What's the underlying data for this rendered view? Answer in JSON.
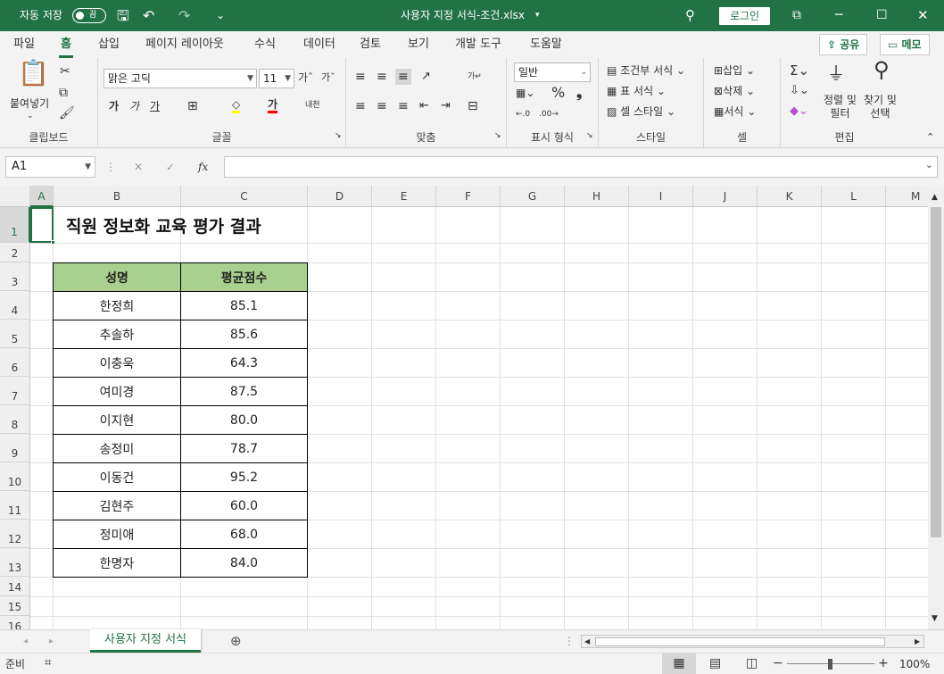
{
  "titlebar": {
    "autosave_label": "자동 저장",
    "autosave_state": "끔",
    "file_title": "사용자 지정 서식-조건.xlsx",
    "login": "로그인"
  },
  "tabs": [
    "파일",
    "홈",
    "삽입",
    "페이지 레이아웃",
    "수식",
    "데이터",
    "검토",
    "보기",
    "개발 도구",
    "도움말"
  ],
  "share_label": "공유",
  "memo_label": "메모",
  "ribbon": {
    "clipboard": {
      "paste": "붙여넣기",
      "label": "클립보드"
    },
    "font": {
      "name": "맑은 고딕",
      "size": "11",
      "label": "글꼴",
      "bold": "가",
      "italic": "가",
      "underline": "가",
      "color_glyph": "가"
    },
    "align": {
      "label": "맞춤"
    },
    "number": {
      "format": "일반",
      "label": "표시 형식",
      "percent": "%"
    },
    "styles": {
      "conditional": "조건부 서식",
      "table": "표 서식",
      "cell": "셀 스타일",
      "label": "스타일"
    },
    "cells": {
      "insert": "삽입",
      "delete": "삭제",
      "format": "서식",
      "label": "셀"
    },
    "editing": {
      "sort": "정렬 및\n필터",
      "find": "찾기 및\n선택",
      "label": "편집"
    }
  },
  "namebox": "A1",
  "columns": [
    "A",
    "B",
    "C",
    "D",
    "E",
    "F",
    "G",
    "H",
    "I",
    "J",
    "K",
    "L",
    "M"
  ],
  "rows": [
    "1",
    "2",
    "3",
    "4",
    "5",
    "6",
    "7",
    "8",
    "9",
    "10",
    "11",
    "12",
    "13",
    "14",
    "15",
    "16"
  ],
  "sheet": {
    "title": "직원 정보화 교육 평가 결과",
    "headers": [
      "성명",
      "평균점수"
    ],
    "data": [
      [
        "한정희",
        "85.1"
      ],
      [
        "추솔하",
        "85.6"
      ],
      [
        "이충욱",
        "64.3"
      ],
      [
        "여미경",
        "87.5"
      ],
      [
        "이지현",
        "80.0"
      ],
      [
        "송정미",
        "78.7"
      ],
      [
        "이동건",
        "95.2"
      ],
      [
        "김현주",
        "60.0"
      ],
      [
        "정미애",
        "68.0"
      ],
      [
        "한명자",
        "84.0"
      ]
    ]
  },
  "sheet_tab": "사용자 지정 서식",
  "status": {
    "ready": "준비",
    "zoom": "100%"
  }
}
